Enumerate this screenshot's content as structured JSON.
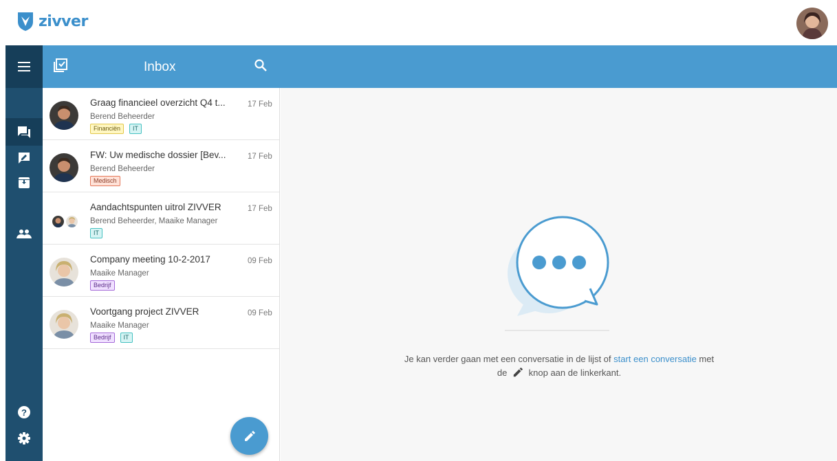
{
  "app": {
    "logo_text": "zivver"
  },
  "colors": {
    "brand": "#3b8fcb",
    "header": "#4a9bd0",
    "nav": "#1f4f6f",
    "nav_active": "#163e59"
  },
  "nav": {
    "items": [
      {
        "icon": "menu-icon"
      },
      {
        "icon": "inbox-icon",
        "active": true
      },
      {
        "icon": "drafts-icon"
      },
      {
        "icon": "archive-icon"
      },
      {
        "icon": "contacts-icon"
      },
      {
        "icon": "help-icon"
      },
      {
        "icon": "settings-icon"
      }
    ]
  },
  "list_header": {
    "title": "Inbox",
    "left_icon": "select-all-icon",
    "right_icon": "search-icon"
  },
  "conversations": [
    {
      "subject": "Graag financieel overzicht Q4 t...",
      "sender": "Berend Beheerder",
      "date": "17 Feb",
      "tags": [
        "Financiën",
        "IT"
      ]
    },
    {
      "subject": "FW: Uw medische dossier [Bev...",
      "sender": "Berend Beheerder",
      "date": "17 Feb",
      "tags": [
        "Medisch"
      ]
    },
    {
      "subject": "Aandachtspunten uitrol ZIVVER",
      "sender": "Berend Beheerder, Maaike Manager",
      "date": "17 Feb",
      "tags": [
        "IT"
      ]
    },
    {
      "subject": "Company meeting 10-2-2017",
      "sender": "Maaike Manager",
      "date": "09 Feb",
      "tags": [
        "Bedrijf"
      ]
    },
    {
      "subject": "Voortgang project ZIVVER",
      "sender": "Maaike Manager",
      "date": "09 Feb",
      "tags": [
        "Bedrijf",
        "IT"
      ]
    }
  ],
  "empty_state": {
    "text_before": "Je kan verder gaan met een conversatie in de lijst of ",
    "link": "start een conversatie",
    "text_after": " met",
    "line2_before": "de",
    "line2_after": "knop aan de linkerkant."
  }
}
